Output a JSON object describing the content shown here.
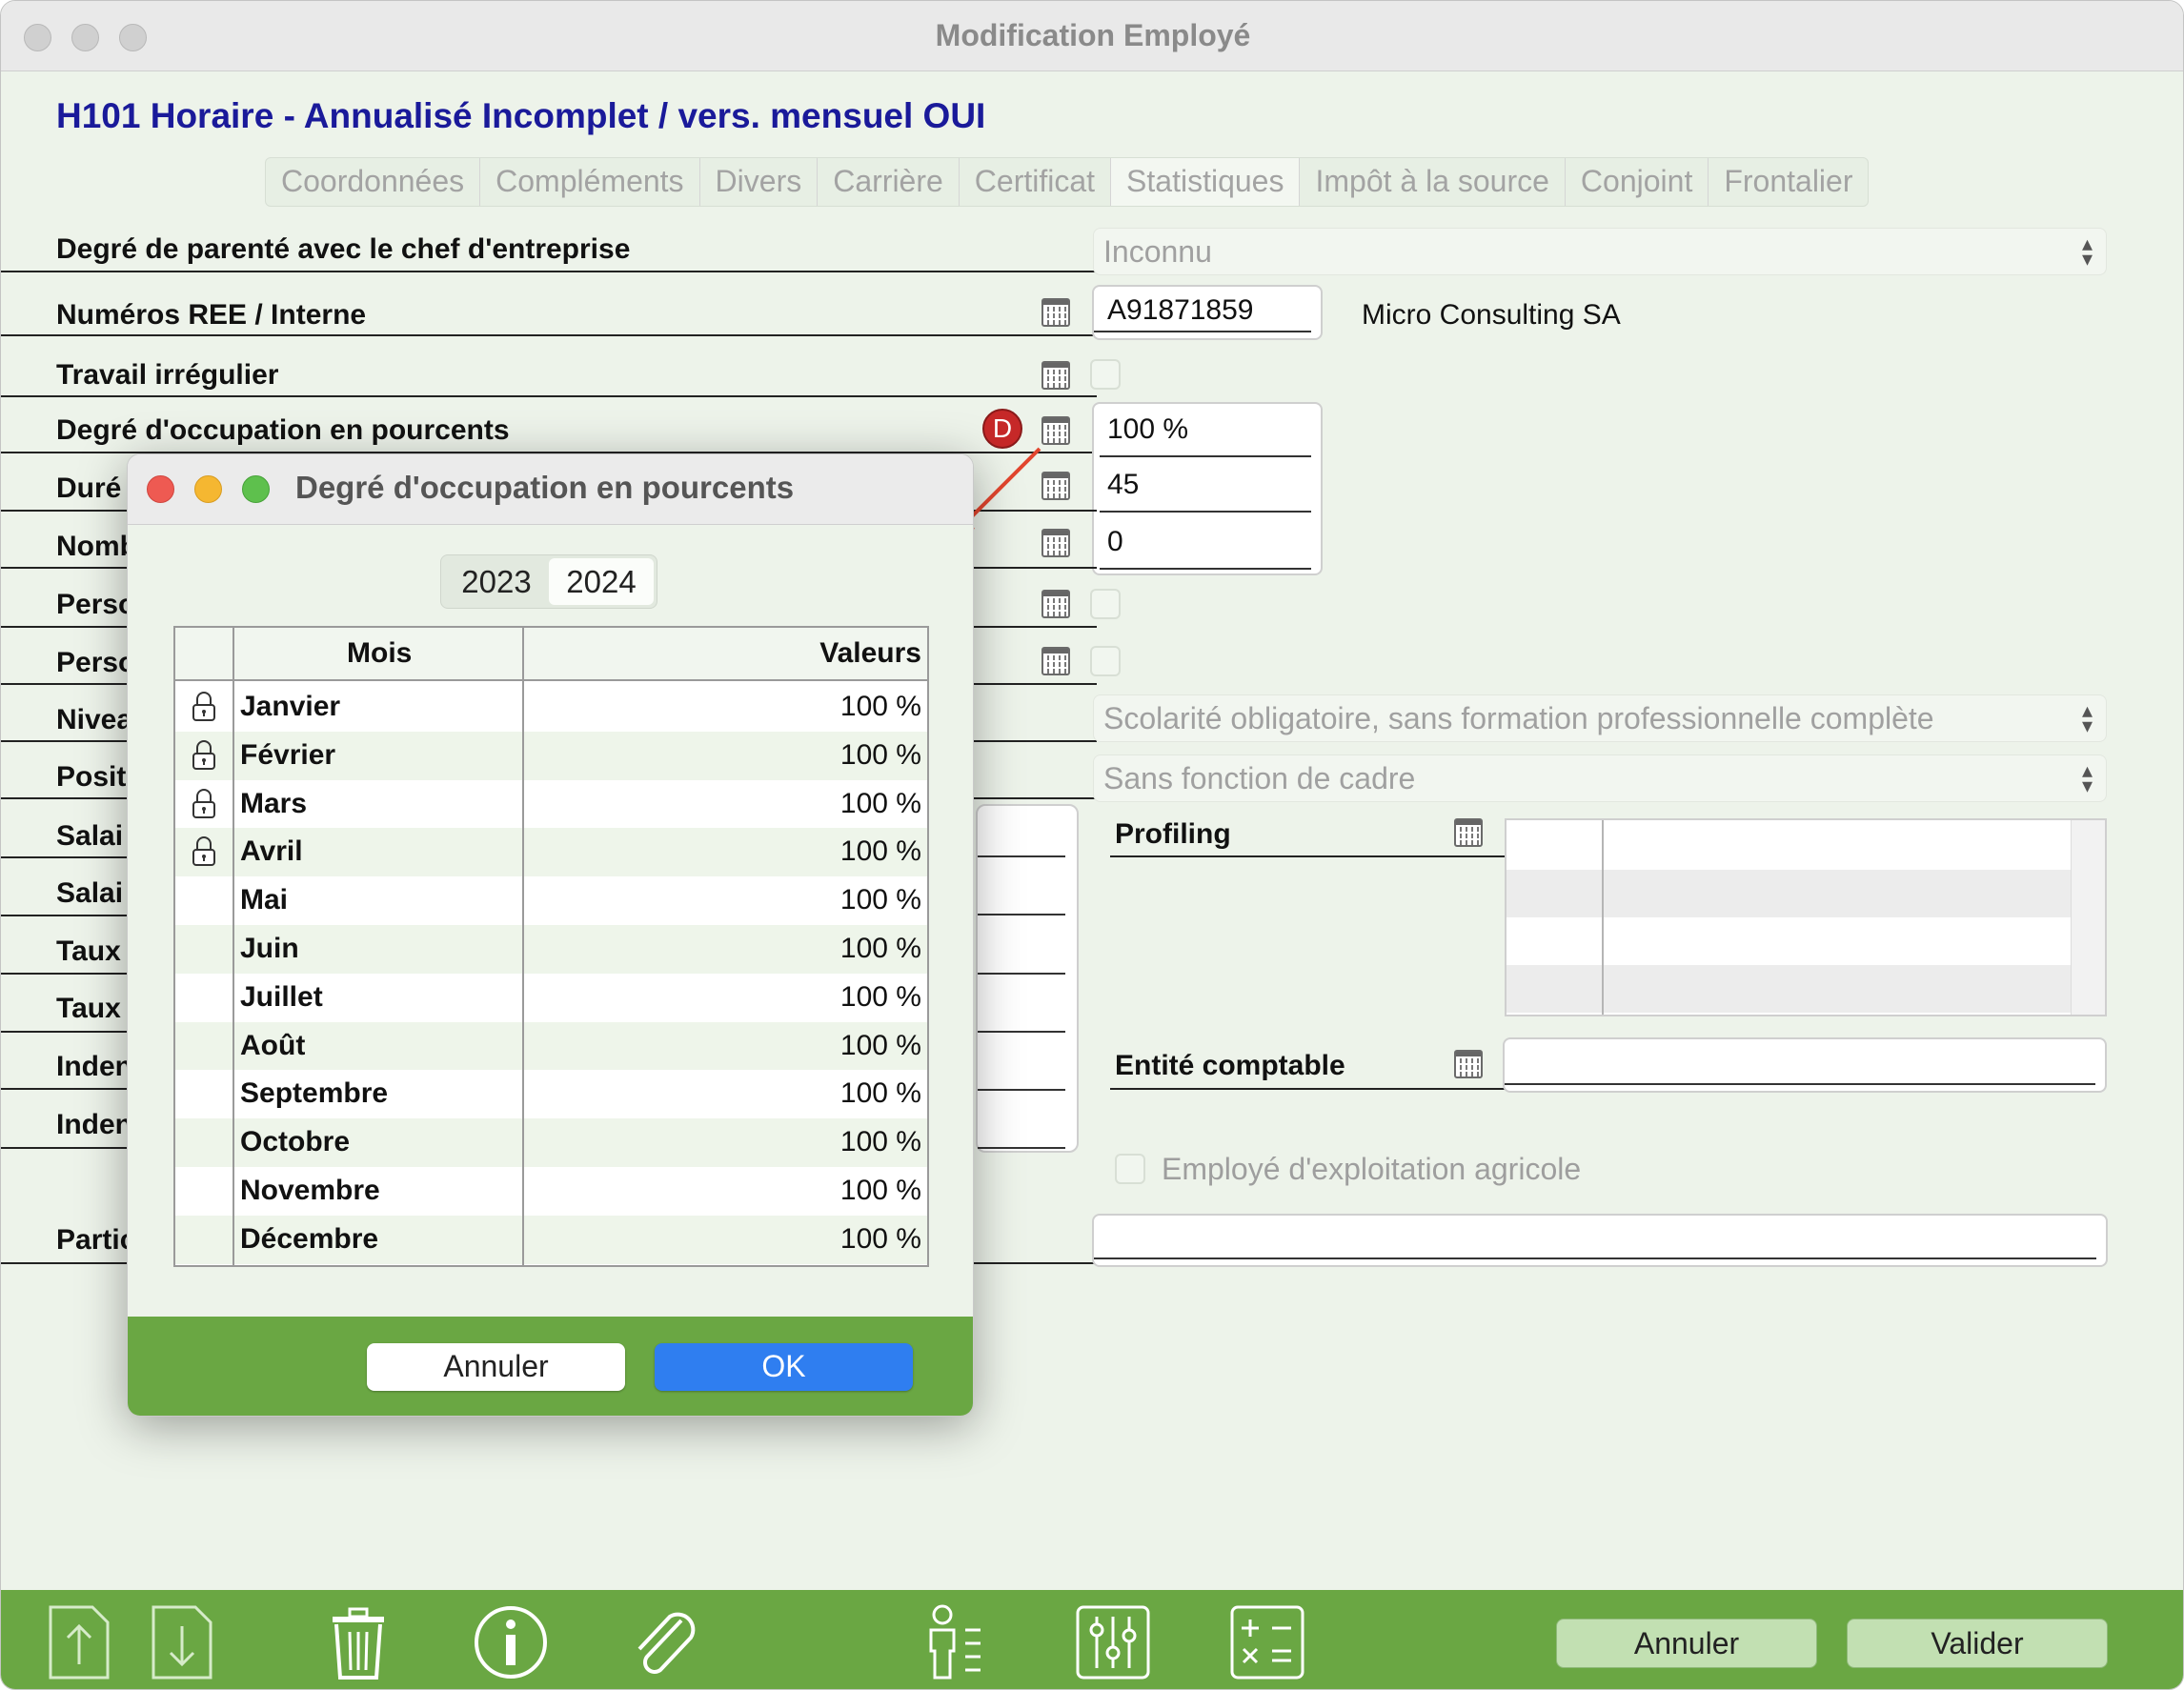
{
  "window": {
    "title": "Modification Employé"
  },
  "header": {
    "title": "H101 Horaire - Annualisé Incomplet / vers. mensuel OUI"
  },
  "tabs": [
    "Coordonnées",
    "Compléments",
    "Divers",
    "Carrière",
    "Certificat",
    "Statistiques",
    "Impôt à la source",
    "Conjoint",
    "Frontalier"
  ],
  "form": {
    "parente_label": "Degré de parenté avec le chef d'entreprise",
    "parente_value": "Inconnu",
    "numeros_label": "Numéros REE / Interne",
    "numeros_value": "A91871859",
    "company": "Micro Consulting SA",
    "travail_label": "Travail irrégulier",
    "degre_label": "Degré d'occupation en pourcents",
    "degre_value": "100 %",
    "badge": "D",
    "duree_label": "Duré",
    "duree_value": "45",
    "nom_label": "Nomb",
    "nom_value": "0",
    "pers1_label": "Perso",
    "pers2_label": "Perso",
    "niveau_label": "Nivea",
    "niveau_value": "Scolarité obligatoire, sans formation professionnelle complète",
    "position_label": "Positi",
    "position_value": "Sans fonction de cadre",
    "salaire1_label": "Salai",
    "salaire2_label": "Salai",
    "taux1_label": "Taux",
    "taux2_label": "Taux",
    "indem1_label": "Inden",
    "indem2_label": "Inden",
    "parti_label": "Partic",
    "profiling_label": "Profiling",
    "entite_label": "Entité comptable",
    "agricole_label": "Employé d'exploitation agricole"
  },
  "dialog": {
    "title": "Degré d'occupation en pourcents",
    "years": [
      "2023",
      "2024"
    ],
    "selected_year": "2024",
    "col_mois": "Mois",
    "col_valeurs": "Valeurs",
    "rows": [
      {
        "mois": "Janvier",
        "valeur": "100 %",
        "locked": true
      },
      {
        "mois": "Février",
        "valeur": "100 %",
        "locked": true
      },
      {
        "mois": "Mars",
        "valeur": "100 %",
        "locked": true
      },
      {
        "mois": "Avril",
        "valeur": "100 %",
        "locked": true
      },
      {
        "mois": "Mai",
        "valeur": "100 %",
        "locked": false
      },
      {
        "mois": "Juin",
        "valeur": "100 %",
        "locked": false
      },
      {
        "mois": "Juillet",
        "valeur": "100 %",
        "locked": false
      },
      {
        "mois": "Août",
        "valeur": "100 %",
        "locked": false
      },
      {
        "mois": "Septembre",
        "valeur": "100 %",
        "locked": false
      },
      {
        "mois": "Octobre",
        "valeur": "100 %",
        "locked": false
      },
      {
        "mois": "Novembre",
        "valeur": "100 %",
        "locked": false
      },
      {
        "mois": "Décembre",
        "valeur": "100 %",
        "locked": false
      }
    ],
    "cancel": "Annuler",
    "ok": "OK"
  },
  "footer": {
    "icons": [
      "export-icon",
      "import-icon",
      "trash-icon",
      "info-icon",
      "attachment-icon",
      "employee-list-icon",
      "settings-sliders-icon",
      "calculator-icon"
    ],
    "cancel": "Annuler",
    "validate": "Valider"
  },
  "colors": {
    "accent_green": "#6aa743",
    "background": "#edf3ea",
    "title_blue": "#1a1a9a",
    "ok_blue": "#2f7ef0",
    "badge_red": "#c62828"
  }
}
